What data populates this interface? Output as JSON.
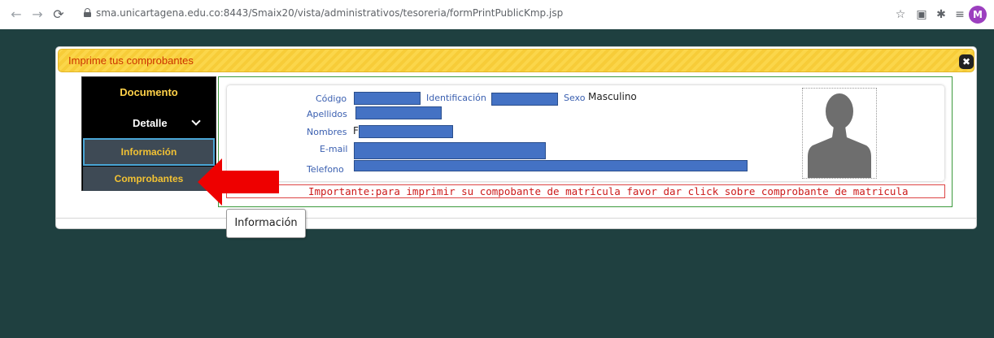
{
  "browser": {
    "url": "sma.unicartagena.edu.co:8443/Smaix20/vista/administrativos/tesoreria/formPrintPublicKmp.jsp",
    "profile_initial": "M",
    "icons": [
      "back-icon",
      "forward-icon",
      "reload-icon",
      "lock-icon",
      "star-icon",
      "cast-icon",
      "extensions-icon",
      "reading-list-icon"
    ]
  },
  "dialog": {
    "title": "Imprime tus comprobantes",
    "close_label": "✖"
  },
  "menu": {
    "documento": "Documento",
    "detalle": "Detalle",
    "informacion": "Información",
    "comprobantes": "Comprobantes"
  },
  "profile": {
    "codigo_label": "Código",
    "identificacion_label": "Identificación",
    "sexo_label": "Sexo",
    "sexo_value": "Masculino",
    "apellidos_label": "Apellidos",
    "nombres_label": "Nombres",
    "nombres_initial": "F",
    "email_label": "E-mail",
    "telefono_label": "Telefono"
  },
  "notice": "Importante:para imprimir su compobante de matrícula favor dar click sobre comprobante de matricula",
  "tooltip": "Información",
  "colors": {
    "page_bg": "#1f4040",
    "header_yellow": "#fbd64a",
    "menu_gold": "#f2c233",
    "label_blue": "#3a5fb0",
    "redaction_blue": "#4472c4",
    "alert_red": "#cc1a1a",
    "arrow_red": "#ee0000"
  }
}
